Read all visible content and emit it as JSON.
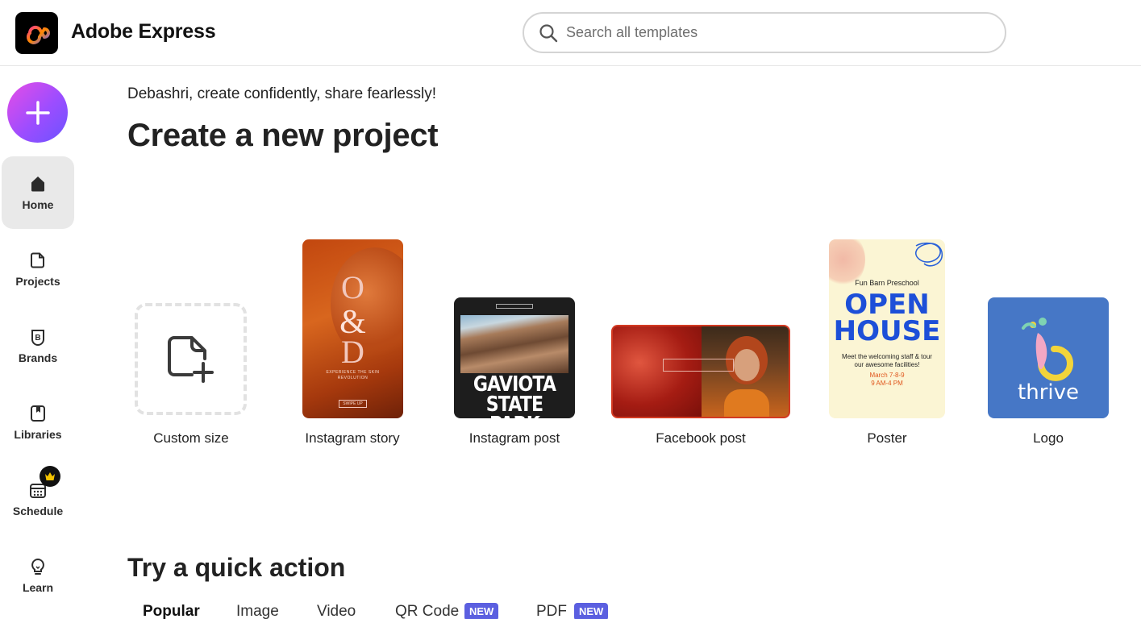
{
  "header": {
    "app_title": "Adobe Express",
    "search_placeholder": "Search all templates"
  },
  "sidebar": {
    "create_button_icon": "plus-icon",
    "items": [
      {
        "label": "Home",
        "icon": "home-icon",
        "active": true
      },
      {
        "label": "Projects",
        "icon": "document-icon"
      },
      {
        "label": "Brands",
        "icon": "brand-icon"
      },
      {
        "label": "Libraries",
        "icon": "library-icon"
      },
      {
        "label": "Schedule",
        "icon": "calendar-icon",
        "badge_icon": "crown-icon"
      },
      {
        "label": "Learn",
        "icon": "lightbulb-icon"
      }
    ]
  },
  "main": {
    "greeting": "Debashri, create confidently, share fearlessly!",
    "title": "Create a new project",
    "cards": [
      {
        "label": "Custom size"
      },
      {
        "label": "Instagram story",
        "thumb_text": [
          "O",
          "&",
          "D",
          "EXPERIENCE THE SKIN REVOLUTION",
          "SWIPE UP"
        ]
      },
      {
        "label": "Instagram post",
        "thumb_text": [
          "GAVIOTA",
          "STATE PARK"
        ]
      },
      {
        "label": "Facebook post"
      },
      {
        "label": "Poster",
        "thumb_text": [
          "Fun Barn Preschool",
          "OPEN",
          "HOUSE",
          "Meet the welcoming staff & tour our awesome facilities!",
          "March 7-8-9",
          "9 AM-4 PM"
        ]
      },
      {
        "label": "Logo",
        "thumb_text": [
          "thrive"
        ]
      }
    ],
    "quick_action_title": "Try a quick action",
    "tabs": [
      {
        "label": "Popular",
        "active": true
      },
      {
        "label": "Image"
      },
      {
        "label": "Video"
      },
      {
        "label": "QR Code",
        "badge": "NEW"
      },
      {
        "label": "PDF",
        "badge": "NEW"
      }
    ]
  },
  "colors": {
    "accent_gradient_start": "#e64de6",
    "accent_gradient_end": "#6b53ff",
    "new_badge": "#5b5fe0",
    "active_nav_bg": "#e9e9e9"
  }
}
